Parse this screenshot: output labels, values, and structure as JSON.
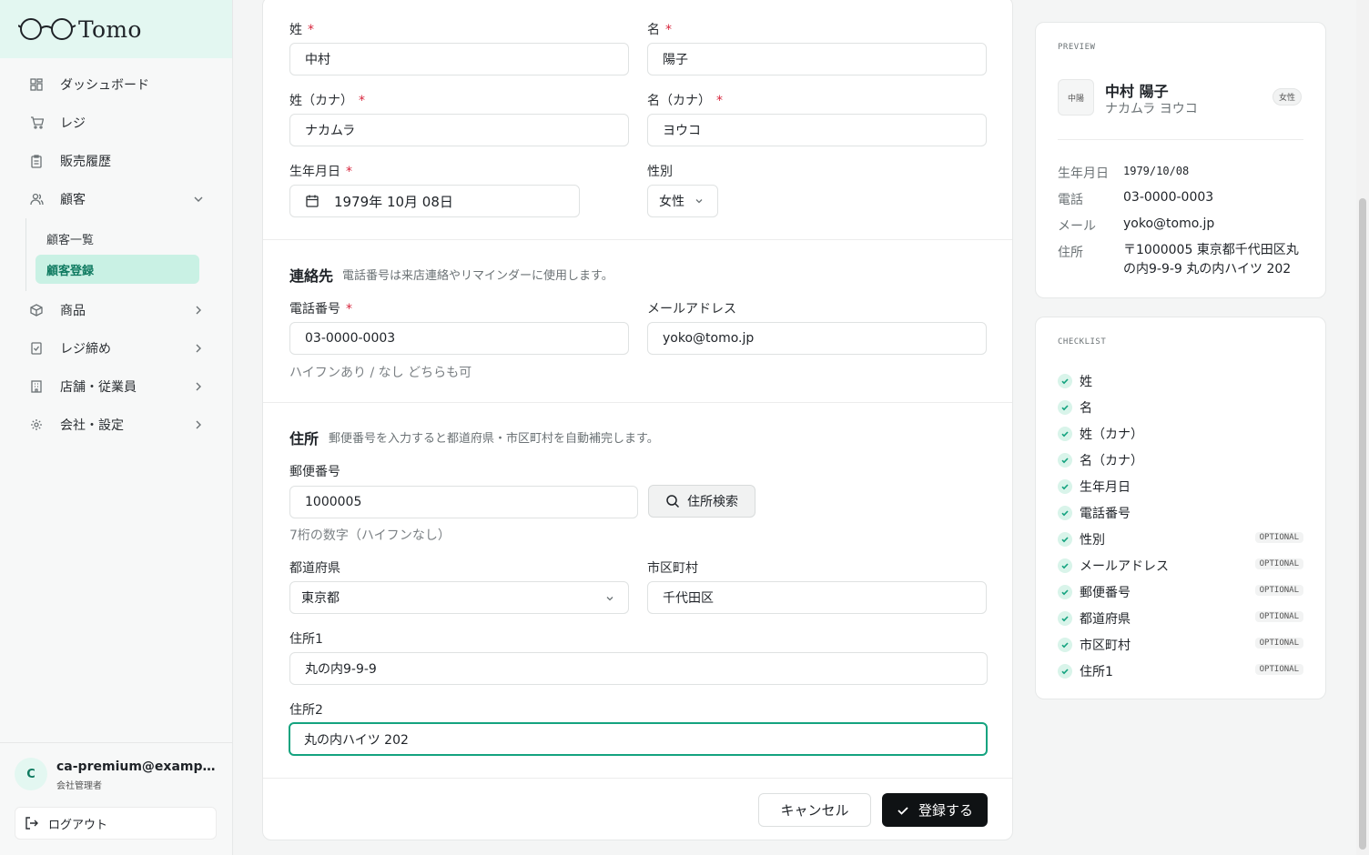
{
  "brand": {
    "name": "Tomo"
  },
  "sidebar": {
    "items": [
      {
        "label": "ダッシュボード",
        "icon": "grid-icon"
      },
      {
        "label": "レジ",
        "icon": "cart-icon"
      },
      {
        "label": "販売履歴",
        "icon": "clipboard-icon"
      },
      {
        "label": "顧客",
        "icon": "users-icon"
      },
      {
        "label": "商品",
        "icon": "box-icon"
      },
      {
        "label": "レジ締め",
        "icon": "checklist-icon"
      },
      {
        "label": "店舗・従業員",
        "icon": "building-icon"
      },
      {
        "label": "会社・設定",
        "icon": "gear-icon"
      }
    ],
    "sub_items": [
      {
        "label": "顧客一覧"
      },
      {
        "label": "顧客登録"
      }
    ]
  },
  "user": {
    "initial": "C",
    "email": "ca-premium@example.com",
    "role": "会社管理者",
    "logout_label": "ログアウト"
  },
  "form": {
    "last_name": {
      "label": "姓",
      "value": "中村"
    },
    "first_name": {
      "label": "名",
      "value": "陽子"
    },
    "last_name_kana": {
      "label": "姓（カナ）",
      "value": "ナカムラ"
    },
    "first_name_kana": {
      "label": "名（カナ）",
      "value": "ヨウコ"
    },
    "birthdate": {
      "label": "生年月日",
      "value": "1979年 10月 08日"
    },
    "gender": {
      "label": "性別",
      "value": "女性"
    },
    "required_mark": "*",
    "contact": {
      "title": "連絡先",
      "desc": "電話番号は来店連絡やリマインダーに使用します。",
      "phone": {
        "label": "電話番号",
        "value": "03-0000-0003",
        "helper": "ハイフンあり / なし どちらも可"
      },
      "email": {
        "label": "メールアドレス",
        "value": "yoko@tomo.jp"
      }
    },
    "address": {
      "title": "住所",
      "desc": "郵便番号を入力すると都道府県・市区町村を自動補完します。",
      "postal": {
        "label": "郵便番号",
        "value": "1000005",
        "helper": "7桁の数字（ハイフンなし）"
      },
      "search_label": "住所検索",
      "prefecture": {
        "label": "都道府県",
        "value": "東京都"
      },
      "city": {
        "label": "市区町村",
        "value": "千代田区"
      },
      "address1": {
        "label": "住所1",
        "value": "丸の内9-9-9"
      },
      "address2": {
        "label": "住所2",
        "value": "丸の内ハイツ 202"
      }
    },
    "cancel_label": "キャンセル",
    "submit_label": "登録する"
  },
  "preview": {
    "heading": "PREVIEW",
    "avatar_text": "中陽",
    "name": "中村 陽子",
    "kana": "ナカムラ ヨウコ",
    "gender_badge": "女性",
    "rows": [
      {
        "label": "生年月日",
        "value": "1979/10/08"
      },
      {
        "label": "電話",
        "value": "03-0000-0003"
      },
      {
        "label": "メール",
        "value": "yoko@tomo.jp"
      },
      {
        "label": "住所",
        "value": "〒1000005 東京都千代田区丸の内9-9-9 丸の内ハイツ 202"
      }
    ]
  },
  "checklist": {
    "heading": "CHECKLIST",
    "optional_label": "OPTIONAL",
    "items": [
      {
        "label": "姓",
        "optional": false
      },
      {
        "label": "名",
        "optional": false
      },
      {
        "label": "姓（カナ）",
        "optional": false
      },
      {
        "label": "名（カナ）",
        "optional": false
      },
      {
        "label": "生年月日",
        "optional": false
      },
      {
        "label": "電話番号",
        "optional": false
      },
      {
        "label": "性別",
        "optional": true
      },
      {
        "label": "メールアドレス",
        "optional": true
      },
      {
        "label": "郵便番号",
        "optional": true
      },
      {
        "label": "都道府県",
        "optional": true
      },
      {
        "label": "市区町村",
        "optional": true
      },
      {
        "label": "住所1",
        "optional": true
      }
    ]
  },
  "colors": {
    "accent": "#14a37f",
    "accent_bg": "#c9f1e4",
    "required": "#d7263d",
    "primary_button": "#0f1214"
  }
}
